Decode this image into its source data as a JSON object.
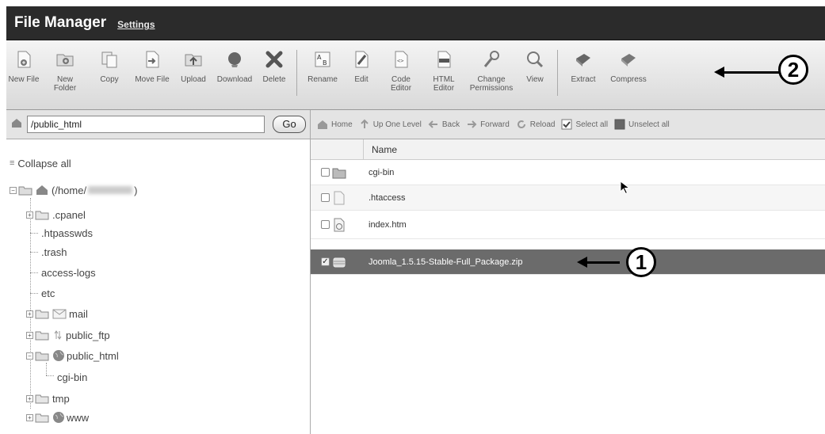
{
  "title_bar": {
    "app_title": "File Manager",
    "settings_link": "Settings"
  },
  "toolbar": {
    "tools": [
      {
        "label": "New File",
        "icon": "new-file-icon"
      },
      {
        "label": "New\nFolder",
        "icon": "new-folder-icon"
      },
      {
        "label": "Copy",
        "icon": "copy-icon"
      },
      {
        "label": "Move File",
        "icon": "move-file-icon"
      },
      {
        "label": "Upload",
        "icon": "upload-icon"
      },
      {
        "label": "Download",
        "icon": "download-icon"
      },
      {
        "label": "Delete",
        "icon": "delete-icon"
      },
      {
        "label": "Rename",
        "icon": "rename-icon"
      },
      {
        "label": "Edit",
        "icon": "edit-icon"
      },
      {
        "label": "Code\nEditor",
        "icon": "code-editor-icon"
      },
      {
        "label": "HTML\nEditor",
        "icon": "html-editor-icon"
      },
      {
        "label": "Change\nPermissions",
        "icon": "permissions-icon"
      },
      {
        "label": "View",
        "icon": "view-icon"
      },
      {
        "label": "Extract",
        "icon": "extract-icon"
      },
      {
        "label": "Compress",
        "icon": "compress-icon"
      }
    ]
  },
  "path_bar": {
    "path_value": "/public_html",
    "go_label": "Go"
  },
  "nav_bar": {
    "home": "Home",
    "up_one_level": "Up One Level",
    "back": "Back",
    "forward": "Forward",
    "reload": "Reload",
    "select_all": "Select all",
    "unselect_all": "Unselect all"
  },
  "tree": {
    "collapse_all": "Collapse all",
    "root_label": "(/home/",
    "root_suffix": ")",
    "items": [
      ".cpanel",
      ".htpasswds",
      ".trash",
      "access-logs",
      "etc",
      "mail",
      "public_ftp",
      "public_html",
      "cgi-bin",
      "tmp",
      "www"
    ]
  },
  "file_list": {
    "column_name": "Name",
    "files": [
      {
        "name": "cgi-bin",
        "type": "folder",
        "selected": false
      },
      {
        "name": ".htaccess",
        "type": "file",
        "selected": false
      },
      {
        "name": "index.htm",
        "type": "html",
        "selected": false
      },
      {
        "name": "Joomla_1.5.15-Stable-Full_Package.zip",
        "type": "zip",
        "selected": true
      }
    ]
  },
  "annotations": {
    "callout_1": "1",
    "callout_2": "2"
  },
  "colors": {
    "title_bg": "#2b2b2b",
    "selected_row": "#6b6b6b",
    "toolbar_bg": "#e6e6e6"
  }
}
